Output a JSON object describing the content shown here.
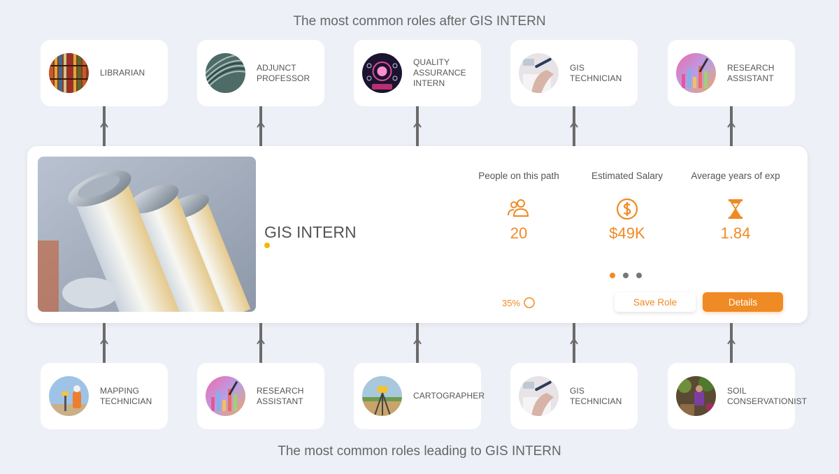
{
  "headings": {
    "after": "The most common roles after GIS INTERN",
    "leading": "The most common roles leading to GIS INTERN"
  },
  "next_roles": [
    {
      "label": "LIBRARIAN",
      "image": "bookshelf-photo"
    },
    {
      "label": "ADJUNCT PROFESSOR",
      "image": "auditorium-photo"
    },
    {
      "label": "QUALITY ASSURANCE INTERN",
      "image": "tech-hologram-photo"
    },
    {
      "label": "GIS TECHNICIAN",
      "image": "pen-writing-photo"
    },
    {
      "label": "RESEARCH ASSISTANT",
      "image": "colorful-chart-photo"
    }
  ],
  "previous_roles": [
    {
      "label": "MAPPING TECHNICIAN",
      "image": "surveyor-photo"
    },
    {
      "label": "RESEARCH ASSISTANT",
      "image": "colorful-chart-photo"
    },
    {
      "label": "CARTOGRAPHER",
      "image": "survey-tripod-photo"
    },
    {
      "label": "GIS TECHNICIAN",
      "image": "pen-writing-photo"
    },
    {
      "label": "SOIL CONSERVATIONIST",
      "image": "soil-field-photo"
    }
  ],
  "main": {
    "title": "GIS INTERN",
    "image": "industrial-cylinders-photo",
    "stats": [
      {
        "label": "People on this path",
        "value": "20",
        "icon": "people-icon"
      },
      {
        "label": "Estimated Salary",
        "value": "$49K",
        "icon": "dollar-icon"
      },
      {
        "label": "Average years of exp",
        "value": "1.84",
        "icon": "hourglass-icon"
      }
    ],
    "progress_label": "35%",
    "pager": {
      "count": 3,
      "active": 1
    },
    "save_label": "Save Role",
    "details_label": "Details"
  },
  "colors": {
    "accent": "#f08a24",
    "title_dot": "#f5b800",
    "background": "#eef0f7",
    "connector": "#6b6b6b"
  }
}
